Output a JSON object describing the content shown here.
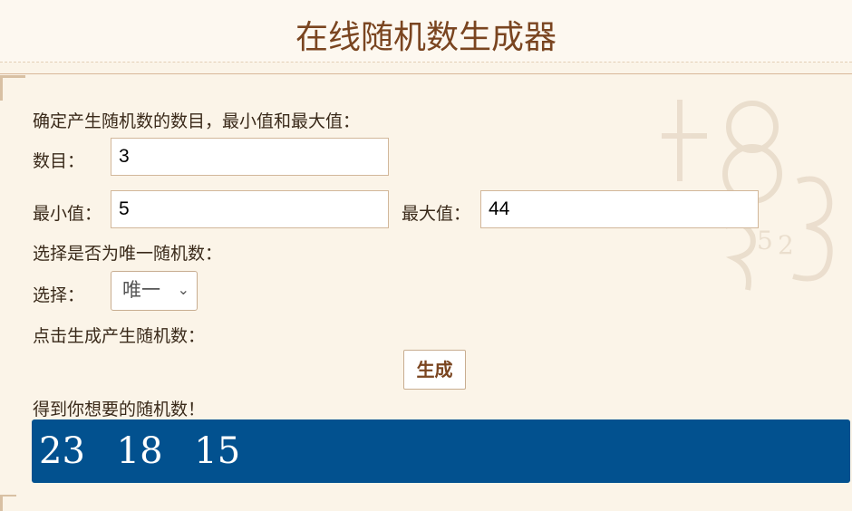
{
  "page": {
    "title": "在线随机数生成器"
  },
  "form": {
    "intro": "确定产生随机数的数目，最小值和最大值：",
    "count_label": "数目：",
    "count_value": "3",
    "min_label": "最小值：",
    "min_value": "5",
    "max_label": "最大值：",
    "max_value": "44",
    "unique_prompt": "选择是否为唯一随机数：",
    "select_label": "选择：",
    "select_value": "唯一",
    "generate_prompt": "点击生成产生随机数：",
    "generate_button": "生成",
    "result_prompt": "得到你想要的随机数！"
  },
  "result": {
    "numbers": [
      "23",
      "18",
      "15"
    ]
  },
  "colors": {
    "accent": "#7a4520",
    "result_bg": "#02518f",
    "page_bg": "#fbf4e8"
  },
  "icons": {
    "select_chevron": "chevron-down-icon"
  }
}
